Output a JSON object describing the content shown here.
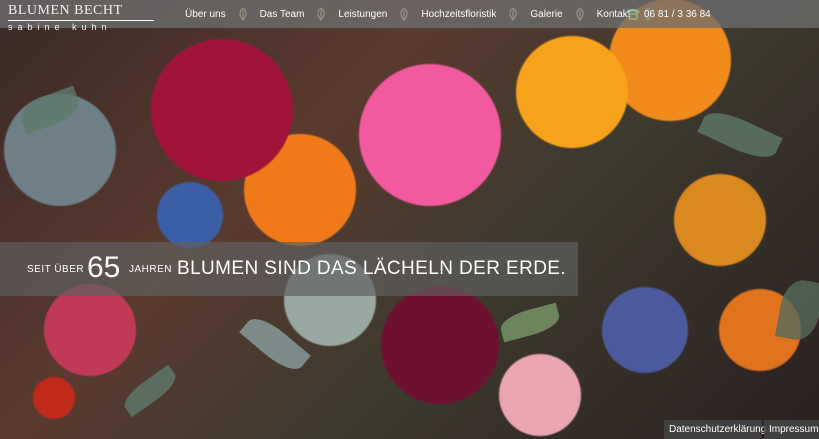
{
  "logo": {
    "name": "BLUMEN BECHT",
    "subtitle": "sabine kuhn"
  },
  "nav": {
    "items": [
      {
        "label": "Über uns"
      },
      {
        "label": "Das Team"
      },
      {
        "label": "Leistungen"
      },
      {
        "label": "Hochzeitsfloristik"
      },
      {
        "label": "Galerie"
      },
      {
        "label": "Kontakt"
      }
    ],
    "separator_icon": "leaf-ornament-icon",
    "phone": {
      "icon": "phone-icon",
      "number": "06 81 / 3 36 84"
    }
  },
  "slogan": {
    "prefix": "SEIT ÜBER",
    "number": "65",
    "suffix": "JAHREN",
    "text": "BLUMEN SIND DAS LÄCHELN DER ERDE."
  },
  "footer": {
    "privacy": "Datenschutzerklärung",
    "imprint": "Impressum"
  },
  "colors": {
    "topbar": "#6e6e6e",
    "band": "#5f5f5f",
    "text": "#ffffff"
  }
}
